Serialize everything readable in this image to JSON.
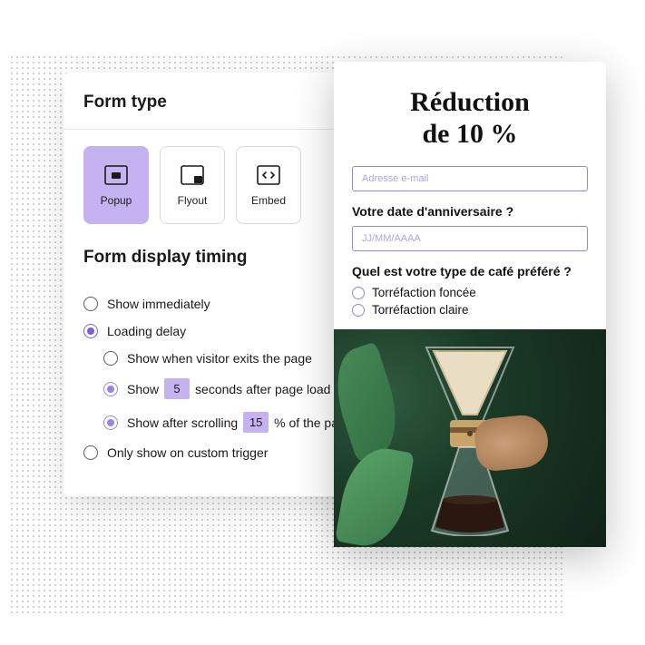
{
  "panel": {
    "form_type_title": "Form type",
    "form_types": {
      "popup": "Popup",
      "flyout": "Flyout",
      "embed": "Embed"
    },
    "timing_title": "Form display timing",
    "timing": {
      "show_immediately": "Show immediately",
      "loading_delay": "Loading delay",
      "exit_intent": "Show when visitor exits the page",
      "show_prefix": "Show",
      "seconds_value": "5",
      "show_suffix": "seconds after page load",
      "scroll_prefix": "Show after scrolling",
      "scroll_value": "15",
      "scroll_suffix": "% of the pa",
      "custom_trigger": "Only show on custom trigger"
    }
  },
  "preview": {
    "title_line1": "Réduction",
    "title_line2": "de 10 %",
    "email_placeholder": "Adresse e-mail",
    "birthday_label": "Votre date d'anniversaire ?",
    "birthday_placeholder": "JJ/MM/AAAA",
    "coffee_label": "Quel est votre type de café préféré ?",
    "coffee_options": {
      "dark": "Torréfaction foncée",
      "light": "Torréfaction claire"
    }
  }
}
